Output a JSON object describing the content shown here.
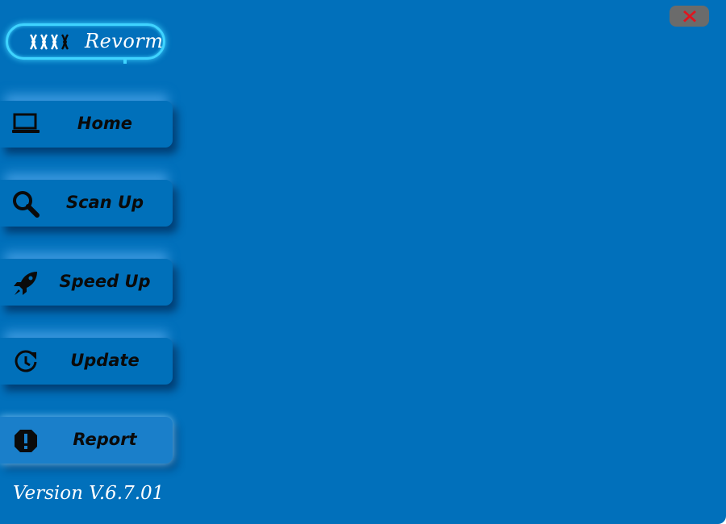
{
  "app": {
    "name": "Revorm",
    "version": "Version V.6.7.01",
    "accent_color": "#3fd4ff",
    "background_color": "#0170bb"
  },
  "window_controls": {
    "close_icon": "close-x-icon",
    "close_color": "#e0141e"
  },
  "nav": {
    "items": [
      {
        "label": "Home",
        "icon": "laptop-icon"
      },
      {
        "label": "Scan Up",
        "icon": "search-icon"
      },
      {
        "label": "Speed Up",
        "icon": "rocket-icon"
      },
      {
        "label": "Update",
        "icon": "clock-refresh-icon"
      },
      {
        "label": "Report",
        "icon": "alert-octagon-icon",
        "active": true
      }
    ]
  }
}
